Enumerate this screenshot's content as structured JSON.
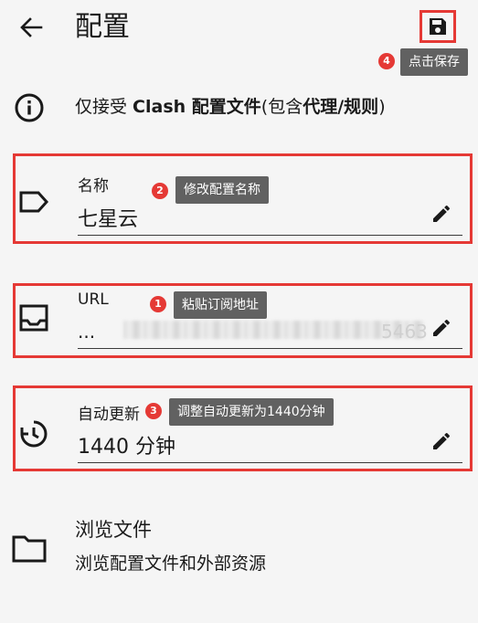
{
  "header": {
    "title": "配置"
  },
  "tips": {
    "t1": {
      "num": "1",
      "text": "粘贴订阅地址"
    },
    "t2": {
      "num": "2",
      "text": "修改配置名称"
    },
    "t3": {
      "num": "3",
      "text": "调整自动更新为1440分钟"
    },
    "t4": {
      "num": "4",
      "text": "点击保存"
    }
  },
  "info": {
    "p1": "仅接受 ",
    "b1": "Clash 配置文件",
    "p2": "(包含",
    "b2": "代理",
    "p3": "/",
    "b3": "规则",
    "p4": ")"
  },
  "fields": {
    "name": {
      "label": "名称",
      "value": "七星云"
    },
    "url": {
      "label": "URL",
      "value_prefix": "...",
      "value_suffix": "5463"
    },
    "update": {
      "label": "自动更新",
      "value": "1440 分钟"
    }
  },
  "browse": {
    "title": "浏览文件",
    "subtitle": "浏览配置文件和外部资源"
  },
  "colors": {
    "highlight": "#e53935",
    "tooltip_bg": "#616161",
    "background": "#f5f5f5"
  }
}
